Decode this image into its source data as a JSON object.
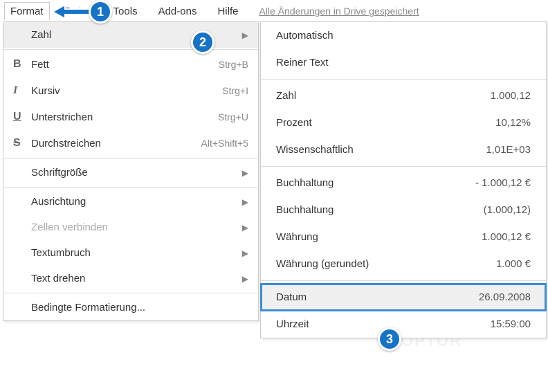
{
  "menubar": {
    "items": [
      "Format",
      "Daten",
      "Tools",
      "Add-ons",
      "Hilfe"
    ],
    "active_index": 0,
    "save_status": "Alle Änderungen in Drive gespeichert"
  },
  "dropdown": {
    "items": [
      {
        "label": "Zahl",
        "submenu": true,
        "highlighted": true
      },
      {
        "divider": true
      },
      {
        "icon": "B",
        "icon_class": "icon-bold",
        "label": "Fett",
        "shortcut": "Strg+B"
      },
      {
        "icon": "I",
        "icon_class": "icon-italic",
        "label": "Kursiv",
        "shortcut": "Strg+I"
      },
      {
        "icon": "U",
        "icon_class": "icon-underline",
        "label": "Unterstrichen",
        "shortcut": "Strg+U"
      },
      {
        "icon": "S",
        "icon_class": "icon-strike",
        "label": "Durchstreichen",
        "shortcut": "Alt+Shift+5"
      },
      {
        "divider": true
      },
      {
        "label": "Schriftgröße",
        "submenu": true
      },
      {
        "divider": true
      },
      {
        "label": "Ausrichtung",
        "submenu": true
      },
      {
        "label": "Zellen verbinden",
        "submenu": true,
        "disabled": true
      },
      {
        "label": "Textumbruch",
        "submenu": true
      },
      {
        "label": "Text drehen",
        "submenu": true
      },
      {
        "divider": true
      },
      {
        "label": "Bedingte Formatierung..."
      }
    ]
  },
  "submenu": {
    "items": [
      {
        "label": "Automatisch"
      },
      {
        "label": "Reiner Text"
      },
      {
        "divider": true
      },
      {
        "label": "Zahl",
        "value": "1.000,12"
      },
      {
        "label": "Prozent",
        "value": "10,12%"
      },
      {
        "label": "Wissenschaftlich",
        "value": "1,01E+03"
      },
      {
        "divider": true
      },
      {
        "label": "Buchhaltung",
        "value": "- 1.000,12 €"
      },
      {
        "label": "Buchhaltung",
        "value": "(1.000,12)"
      },
      {
        "label": "Währung",
        "value": "1.000,12 €"
      },
      {
        "label": "Währung (gerundet)",
        "value": "1.000 €"
      },
      {
        "divider": true
      },
      {
        "label": "Datum",
        "value": "26.09.2008",
        "highlighted": true
      },
      {
        "label": "Uhrzeit",
        "value": "15:59:00"
      }
    ]
  },
  "callouts": {
    "c1": "1",
    "c2": "2",
    "c3": "3"
  },
  "watermark": "OPTOR"
}
